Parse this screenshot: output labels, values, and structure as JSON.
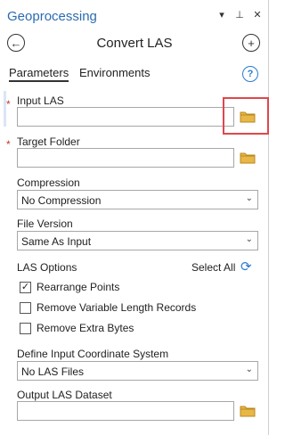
{
  "pane": {
    "title": "Geoprocessing",
    "controls": {
      "menu": "▾",
      "pin": "⊥",
      "close": "✕"
    }
  },
  "tool": {
    "name": "Convert LAS",
    "back_glyph": "←",
    "add_glyph": "+"
  },
  "tabs": [
    {
      "label": "Parameters",
      "active": true
    },
    {
      "label": "Environments",
      "active": false
    }
  ],
  "help_glyph": "?",
  "params": {
    "input_las": {
      "label": "Input LAS",
      "required": true,
      "value": ""
    },
    "target_folder": {
      "label": "Target Folder",
      "required": true,
      "value": ""
    },
    "compression": {
      "label": "Compression",
      "value": "No Compression"
    },
    "file_version": {
      "label": "File Version",
      "value": "Same As Input"
    },
    "las_options": {
      "label": "LAS Options",
      "select_all": "Select All",
      "items": [
        {
          "label": "Rearrange Points",
          "checked": true
        },
        {
          "label": "Remove Variable Length Records",
          "checked": false
        },
        {
          "label": "Remove Extra Bytes",
          "checked": false
        }
      ]
    },
    "coordinate_system": {
      "label": "Define Input Coordinate System",
      "value": "No LAS Files"
    },
    "output_las": {
      "label": "Output LAS Dataset",
      "value": ""
    }
  },
  "required_marker": "*",
  "icons": {
    "folder": "folder-icon",
    "refresh": "refresh-icon",
    "chevron": "chevron-down-icon"
  },
  "colors": {
    "title_blue": "#2b6cb0",
    "folder_fill": "#e8b746",
    "highlight_red": "#e0474c",
    "required_red": "#c0392b"
  }
}
